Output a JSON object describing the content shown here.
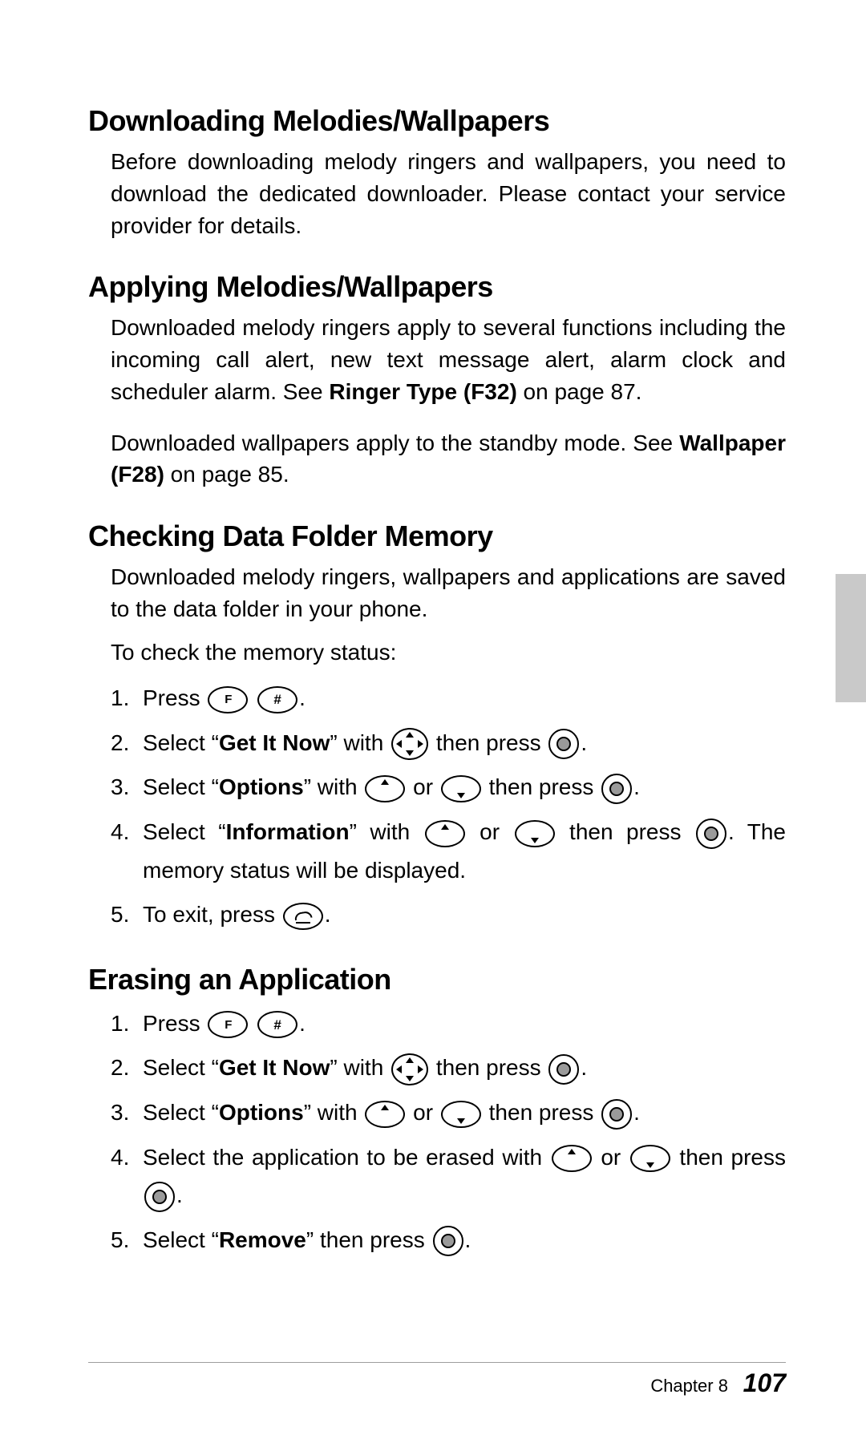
{
  "sections": {
    "s1": {
      "heading": "Downloading Melodies/Wallpapers",
      "p1": "Before downloading melody ringers and wallpapers, you need to download the dedicated downloader. Please contact your service provider for details."
    },
    "s2": {
      "heading": "Applying Melodies/Wallpapers",
      "p1a": "Downloaded melody ringers apply to several functions including the incoming call alert, new text message alert, alarm clock and scheduler alarm. See ",
      "p1b": "Ringer Type (F32)",
      "p1c": " on page 87.",
      "p2a": "Downloaded wallpapers apply to the standby mode. See ",
      "p2b": "Wallpaper (F28)",
      "p2c": " on page 85."
    },
    "s3": {
      "heading": "Checking Data Folder Memory",
      "p1": "Downloaded melody ringers, wallpapers and applications are saved to the data folder in your phone.",
      "p2": "To check the memory status:",
      "steps": {
        "n1": "1.",
        "t1a": "Press ",
        "t1b": ".",
        "n2": "2.",
        "t2a": "Select “",
        "t2b": "Get It Now",
        "t2c": "” with ",
        "t2d": " then press ",
        "t2e": ".",
        "n3": "3.",
        "t3a": "Select “",
        "t3b": "Options",
        "t3c": "” with ",
        "t3d": " or ",
        "t3e": " then press ",
        "t3f": ".",
        "n4": "4.",
        "t4a": "Select “",
        "t4b": "Information",
        "t4c": "” with ",
        "t4d": " or ",
        "t4e": " then press ",
        "t4f": ". The memory status will be displayed.",
        "n5": "5.",
        "t5a": "To exit, press ",
        "t5b": "."
      }
    },
    "s4": {
      "heading": "Erasing an Application",
      "steps": {
        "n1": "1.",
        "t1a": "Press ",
        "t1b": ".",
        "n2": "2.",
        "t2a": "Select “",
        "t2b": "Get It Now",
        "t2c": "” with ",
        "t2d": " then press ",
        "t2e": ".",
        "n3": "3.",
        "t3a": "Select “",
        "t3b": "Options",
        "t3c": "” with ",
        "t3d": " or ",
        "t3e": " then press ",
        "t3f": ".",
        "n4": "4.",
        "t4a": "Select the application to be erased with ",
        "t4b": " or ",
        "t4c": " then press ",
        "t4d": ".",
        "n5": "5.",
        "t5a": "Select “",
        "t5b": "Remove",
        "t5c": "” then press ",
        "t5d": "."
      }
    }
  },
  "keys": {
    "fkey_label": "F",
    "hash_label": "#"
  },
  "footer": {
    "chapter": "Chapter 8",
    "page": "107"
  }
}
